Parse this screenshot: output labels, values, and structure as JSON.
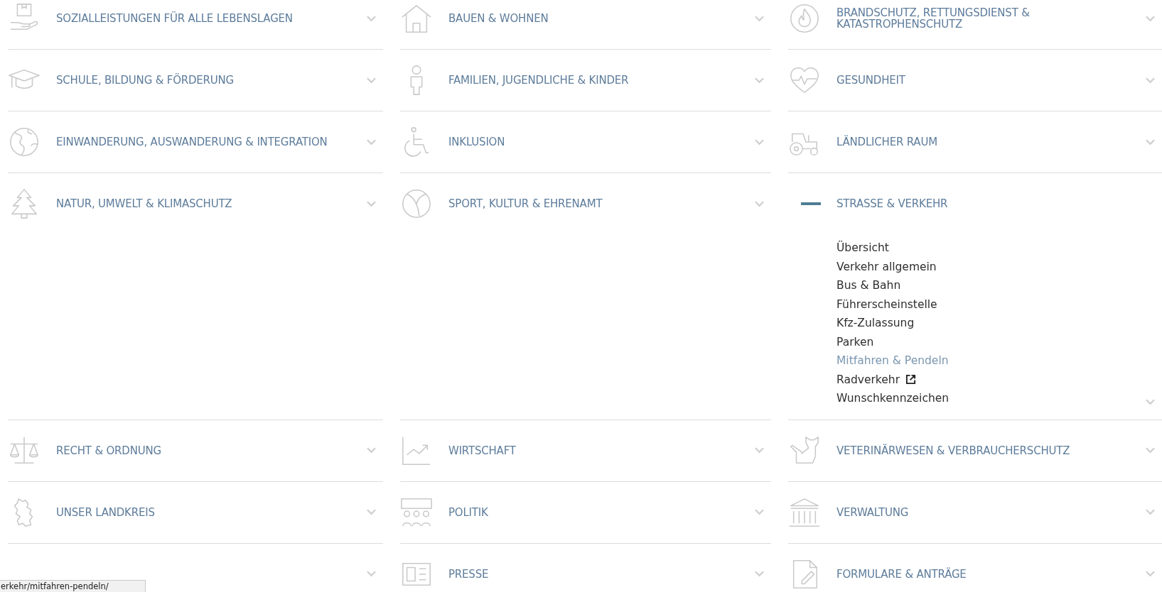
{
  "categories": [
    {
      "title": "SOZIALLEISTUNGEN FÜR ALLE LEBENSLAGEN",
      "expanded": false
    },
    {
      "title": "BAUEN & WOHNEN",
      "expanded": false
    },
    {
      "title": "BRANDSCHUTZ, RETTUNGSDIENST & KATASTROPHENSCHUTZ",
      "expanded": false
    },
    {
      "title": "SCHULE, BILDUNG & FÖRDERUNG",
      "expanded": false
    },
    {
      "title": "FAMILIEN, JUGENDLICHE & KINDER",
      "expanded": false
    },
    {
      "title": "GESUNDHEIT",
      "expanded": false
    },
    {
      "title": "EINWANDERUNG, AUSWANDERUNG & INTEGRATION",
      "expanded": false
    },
    {
      "title": "INKLUSION",
      "expanded": false
    },
    {
      "title": "LÄNDLICHER RAUM",
      "expanded": false
    },
    {
      "title": "NATUR, UMWELT & KLIMASCHUTZ",
      "expanded": false
    },
    {
      "title": "SPORT, KULTUR & EHRENAMT",
      "expanded": false
    },
    {
      "title": "STRASSE & VERKEHR",
      "expanded": true,
      "links": [
        {
          "label": "Übersicht",
          "selected": false,
          "external": false
        },
        {
          "label": "Verkehr allgemein",
          "selected": false,
          "external": false
        },
        {
          "label": "Bus & Bahn",
          "selected": false,
          "external": false
        },
        {
          "label": "Führerscheinstelle",
          "selected": false,
          "external": false
        },
        {
          "label": "Kfz-Zulassung",
          "selected": false,
          "external": false
        },
        {
          "label": "Parken",
          "selected": false,
          "external": false
        },
        {
          "label": "Mitfahren & Pendeln",
          "selected": true,
          "external": false
        },
        {
          "label": "Radverkehr",
          "selected": false,
          "external": true
        },
        {
          "label": "Wunschkennzeichen",
          "selected": false,
          "external": false
        }
      ]
    },
    {
      "title": "RECHT & ORDNUNG",
      "expanded": false
    },
    {
      "title": "WIRTSCHAFT",
      "expanded": false
    },
    {
      "title": "VETERINÄRWESEN & VERBRAUCHERSCHUTZ",
      "expanded": false
    },
    {
      "title": "UNSER LANDKREIS",
      "expanded": false
    },
    {
      "title": "POLITIK",
      "expanded": false
    },
    {
      "title": "VERWALTUNG",
      "expanded": false
    },
    {
      "expanded": false
    },
    {
      "title": "PRESSE",
      "expanded": false
    },
    {
      "title": "FORMULARE & ANTRÄGE",
      "expanded": false
    }
  ],
  "status_url": "erkehr/mitfahren-pendeln/"
}
